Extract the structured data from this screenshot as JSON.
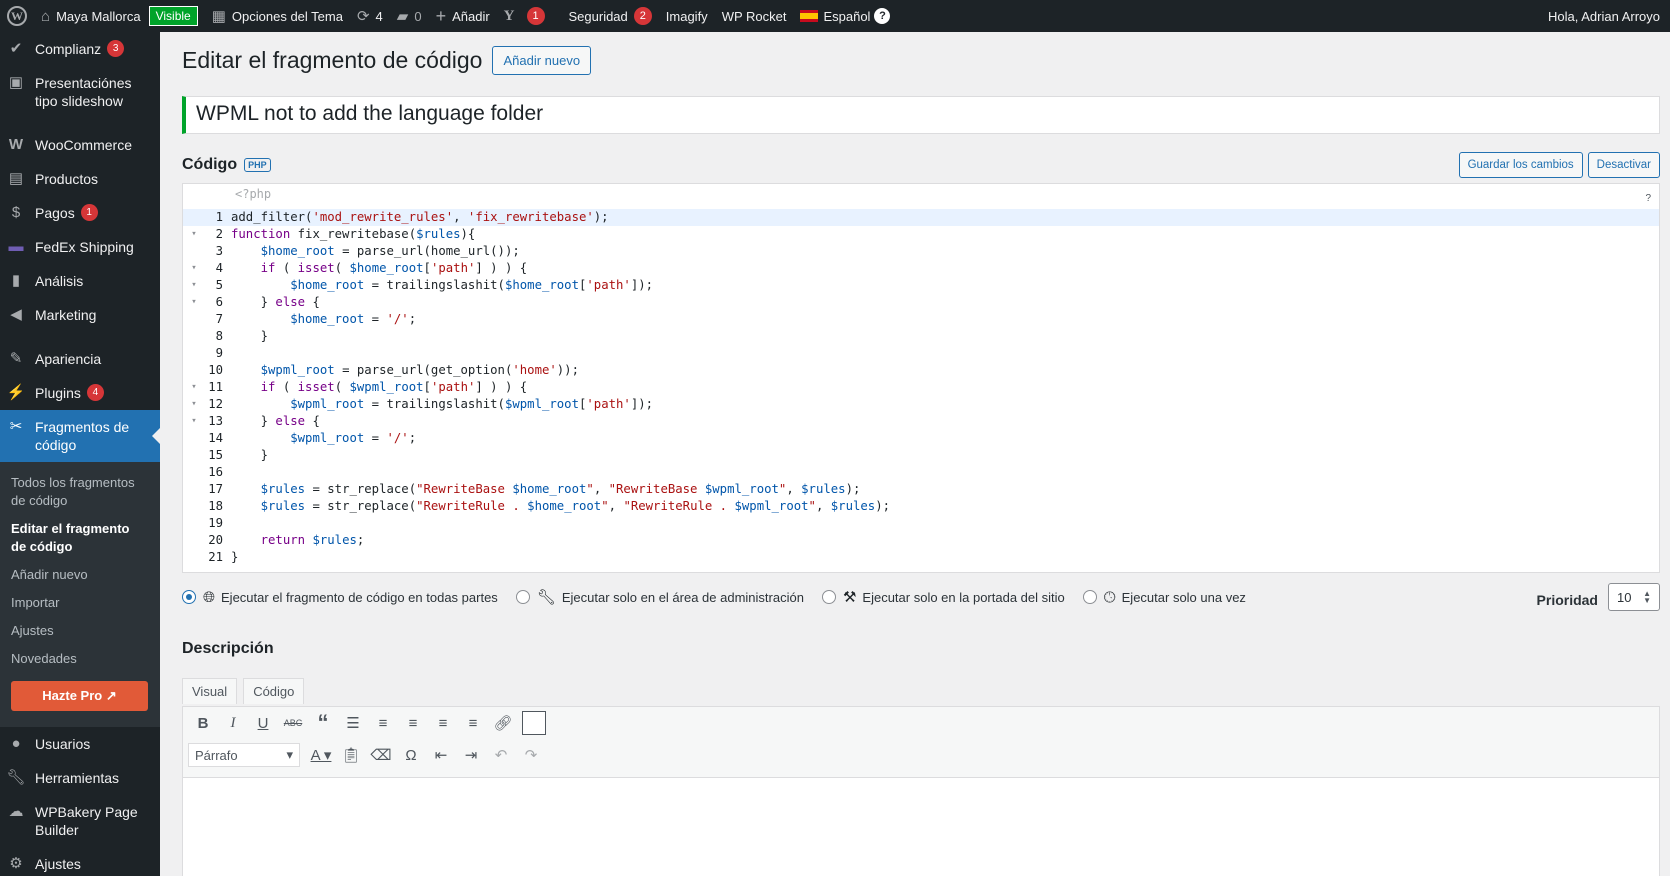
{
  "adminbar": {
    "site_name": "Maya Mallorca",
    "visible_badge": "Visible",
    "theme_options": "Opciones del Tema",
    "updates_count": "4",
    "comments_count": "0",
    "add_new": "Añadir",
    "yoast_badge": "1",
    "security": "Seguridad",
    "security_badge": "2",
    "imagify": "Imagify",
    "wp_rocket": "WP Rocket",
    "language": "Español",
    "help_glyph": "?",
    "greeting": "Hola, Adrian Arroyo"
  },
  "sidebar": {
    "items": [
      {
        "label": "Complianz",
        "badge": "3",
        "icon": "check-icon"
      },
      {
        "label": "Presentaciónes tipo slideshow",
        "icon": "image-icon"
      },
      {
        "label": "WooCommerce",
        "icon": "woo-icon"
      },
      {
        "label": "Productos",
        "icon": "archive-icon"
      },
      {
        "label": "Pagos",
        "badge": "1",
        "icon": "dollar-icon"
      },
      {
        "label": "FedEx Shipping",
        "icon": "truck-icon"
      },
      {
        "label": "Análisis",
        "icon": "bar-chart-icon"
      },
      {
        "label": "Marketing",
        "icon": "megaphone-icon"
      },
      {
        "label": "Apariencia",
        "icon": "brush-icon"
      },
      {
        "label": "Plugins",
        "badge": "4",
        "icon": "plugin-icon"
      },
      {
        "label": "Fragmentos de código",
        "icon": "scissors-icon"
      }
    ],
    "submenu": [
      "Todos los fragmentos de código",
      "Editar el fragmento de código",
      "Añadir nuevo",
      "Importar",
      "Ajustes",
      "Novedades"
    ],
    "hazte_pro": "Hazte Pro",
    "bottom_items": [
      {
        "label": "Usuarios",
        "icon": "user-icon"
      },
      {
        "label": "Herramientas",
        "icon": "wrench-icon"
      },
      {
        "label": "WPBakery Page Builder",
        "icon": "cloud-icon"
      },
      {
        "label": "Ajustes",
        "icon": "settings-icon"
      }
    ]
  },
  "page": {
    "title": "Editar el fragmento de código",
    "add_new": "Añadir nuevo",
    "snippet_title": "WPML not to add the language folder"
  },
  "code": {
    "label": "Código",
    "lang_badge": "PHP",
    "save_button": "Guardar los cambios",
    "deactivate_button": "Desactivar",
    "php_open": "<?php",
    "help": "?",
    "lines": [
      "add_filter('mod_rewrite_rules', 'fix_rewritebase');",
      "function fix_rewritebase($rules){",
      "    $home_root = parse_url(home_url());",
      "    if ( isset( $home_root['path'] ) ) {",
      "        $home_root = trailingslashit($home_root['path']);",
      "    } else {",
      "        $home_root = '/';",
      "    }",
      "",
      "    $wpml_root = parse_url(get_option('home'));",
      "    if ( isset( $wpml_root['path'] ) ) {",
      "        $wpml_root = trailingslashit($wpml_root['path']);",
      "    } else {",
      "        $wpml_root = '/';",
      "    }",
      "",
      "    $rules = str_replace(\"RewriteBase $home_root\", \"RewriteBase $wpml_root\", $rules);",
      "    $rules = str_replace(\"RewriteRule . $home_root\", \"RewriteRule . $wpml_root\", $rules);",
      "",
      "    return $rules;",
      "}"
    ],
    "fold_lines": [
      2,
      4,
      5,
      6,
      11,
      12,
      13
    ]
  },
  "run_options": {
    "options": [
      {
        "label": "Ejecutar el fragmento de código en todas partes",
        "icon": "globe-icon",
        "checked": true
      },
      {
        "label": "Ejecutar solo en el área de administración",
        "icon": "wrench-icon",
        "checked": false
      },
      {
        "label": "Ejecutar solo en la portada del sitio",
        "icon": "hammer-icon",
        "checked": false
      },
      {
        "label": "Ejecutar solo una vez",
        "icon": "clock-icon",
        "checked": false
      }
    ],
    "priority_label": "Prioridad",
    "priority_value": "10"
  },
  "description": {
    "title": "Descripción",
    "tab_visual": "Visual",
    "tab_code": "Código",
    "format_select": "Párrafo"
  },
  "colors": {
    "accent": "#2271b1",
    "admin_dark": "#1d2327",
    "badge_red": "#d63638",
    "success_green": "#00a32a",
    "pro_orange": "#e15a38"
  }
}
